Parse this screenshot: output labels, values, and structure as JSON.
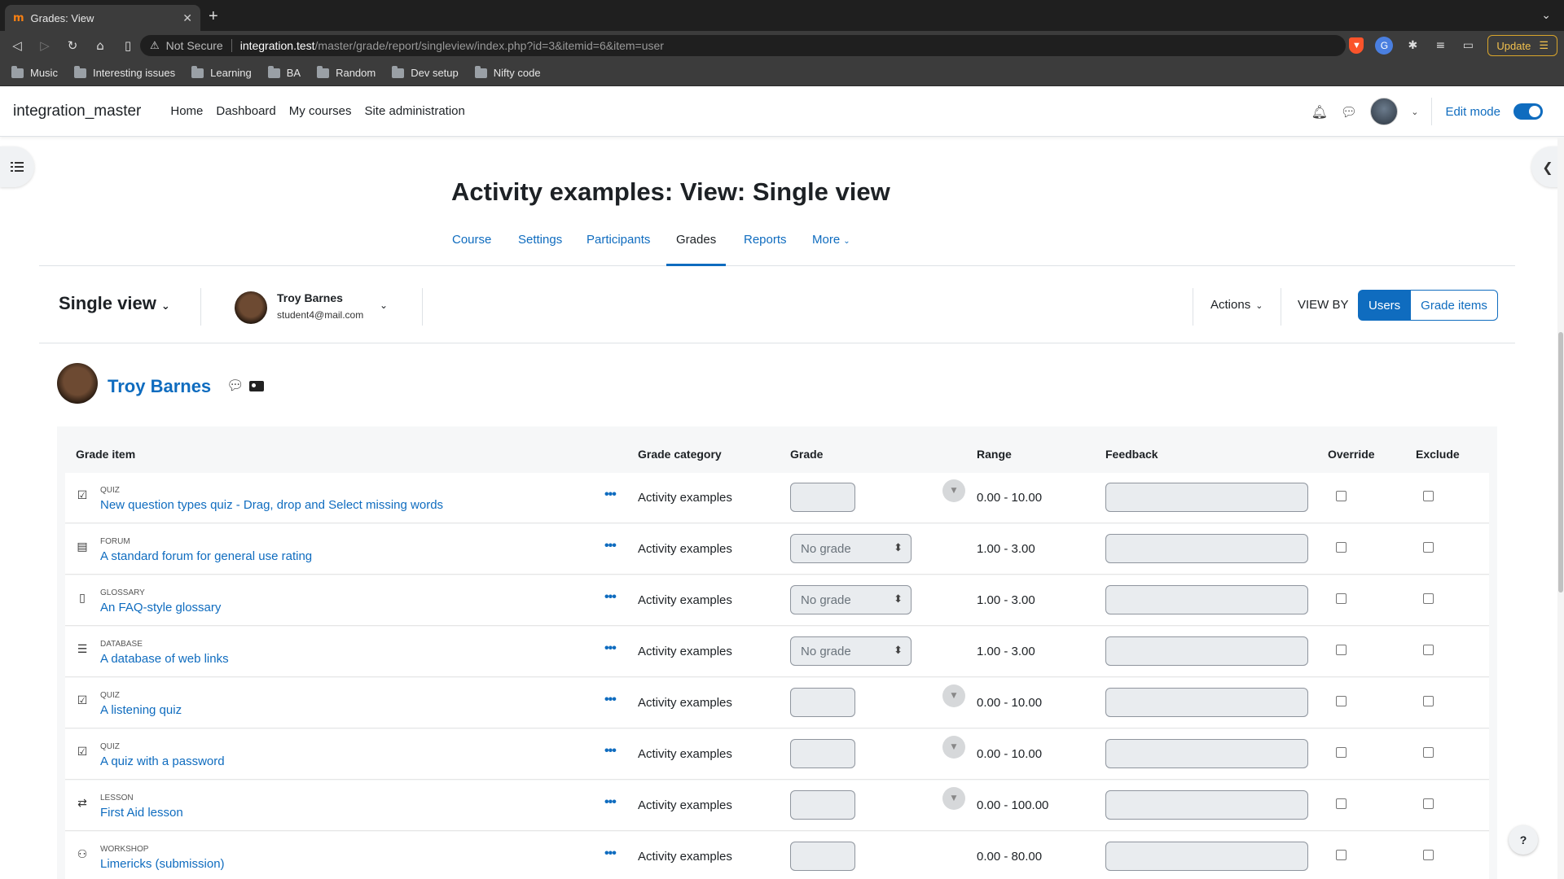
{
  "browser": {
    "tab_title": "Grades: View",
    "tab_favicon": "m",
    "security_label": "Not Secure",
    "url_host": "integration.test",
    "url_path": "/master/grade/report/singleview/index.php?id=3&itemid=6&item=user",
    "update_label": "Update",
    "bookmarks": [
      "Music",
      "Interesting issues",
      "Learning",
      "BA",
      "Random",
      "Dev setup",
      "Nifty code"
    ]
  },
  "navbar": {
    "site_name": "integration_master",
    "items": [
      "Home",
      "Dashboard",
      "My courses",
      "Site administration"
    ],
    "edit_mode_label": "Edit mode"
  },
  "page": {
    "title": "Activity examples: View: Single view",
    "secondary_nav": [
      "Course",
      "Settings",
      "Participants",
      "Grades",
      "Reports",
      "More"
    ],
    "active_tab": "Grades"
  },
  "tertiary": {
    "report_title": "Single view",
    "user_name": "Troy Barnes",
    "user_email": "student4@mail.com",
    "actions_label": "Actions",
    "view_by_label": "VIEW BY",
    "view_users": "Users",
    "view_grade_items": "Grade items"
  },
  "user": {
    "name": "Troy Barnes"
  },
  "table": {
    "headers": {
      "grade_item": "Grade item",
      "grade_category": "Grade category",
      "grade": "Grade",
      "range": "Range",
      "feedback": "Feedback",
      "override": "Override",
      "exclude": "Exclude"
    },
    "rows": [
      {
        "type": "QUIZ",
        "name": "New question types quiz - Drag, drop and Select missing words",
        "category": "Activity examples",
        "grade": "",
        "range": "0.00 - 10.00"
      },
      {
        "type": "FORUM",
        "name": "A standard forum for general use rating",
        "category": "Activity examples",
        "grade": "No grade",
        "range": "1.00 - 3.00"
      },
      {
        "type": "GLOSSARY",
        "name": "An FAQ-style glossary",
        "category": "Activity examples",
        "grade": "No grade",
        "range": "1.00 - 3.00"
      },
      {
        "type": "DATABASE",
        "name": "A database of web links",
        "category": "Activity examples",
        "grade": "No grade",
        "range": "1.00 - 3.00"
      },
      {
        "type": "QUIZ",
        "name": "A listening quiz",
        "category": "Activity examples",
        "grade": "",
        "range": "0.00 - 10.00"
      },
      {
        "type": "QUIZ",
        "name": "A quiz with a password",
        "category": "Activity examples",
        "grade": "",
        "range": "0.00 - 10.00"
      },
      {
        "type": "LESSON",
        "name": "First Aid lesson",
        "category": "Activity examples",
        "grade": "",
        "range": "0.00 - 100.00"
      },
      {
        "type": "WORKSHOP",
        "name": "Limericks (submission)",
        "category": "Activity examples",
        "grade": "",
        "range": "0.00 - 80.00"
      }
    ]
  },
  "help_label": "?",
  "colors": {
    "primary": "#0f6cbf",
    "text": "#1d2125"
  }
}
